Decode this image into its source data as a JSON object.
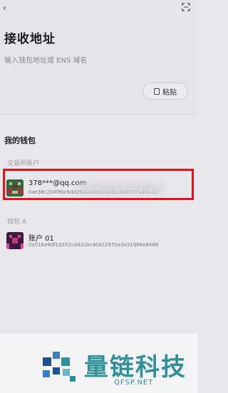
{
  "header": {
    "title": "接收地址",
    "placeholder": "输入钱包地址或 ENS 域名",
    "paste_label": "粘贴"
  },
  "my_wallets": {
    "title": "我的钱包",
    "group_label": "交易所账户",
    "highlighted_account": {
      "name": "378***@qq.com",
      "address": "0xe38c204f9bc6402640e3d1342fb2508577146112"
    },
    "wallet_label": "钱包 A",
    "account": {
      "name": "账户 01",
      "address": "0x516e9df1d352cd42cbc40422970a3e31986e8486"
    }
  },
  "watermark": {
    "text": "量链科技",
    "url": "QFSP.NET"
  }
}
